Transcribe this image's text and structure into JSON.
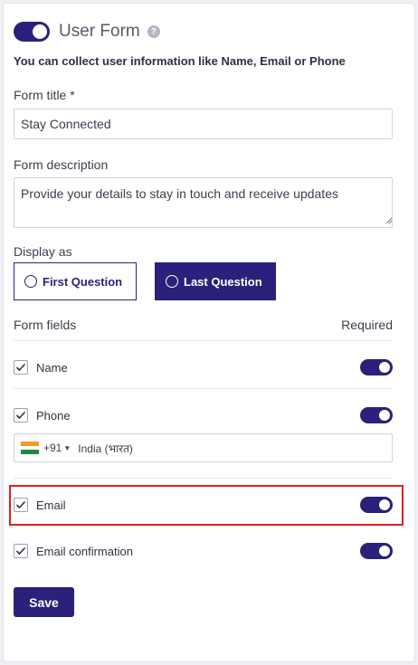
{
  "header": {
    "title": "User Form",
    "help_glyph": "?"
  },
  "subtitle": "You can collect user information like Name, Email or Phone",
  "form_title": {
    "label": "Form title *",
    "value": "Stay Connected"
  },
  "form_description": {
    "label": "Form description",
    "value": "Provide your details to stay in touch and receive updates"
  },
  "display_as": {
    "label": "Display as",
    "options": [
      "First Question",
      "Last Question"
    ],
    "selected": "Last Question"
  },
  "fields_header": {
    "left": "Form fields",
    "right": "Required"
  },
  "fields": [
    {
      "label": "Name",
      "checked": true,
      "required": true
    },
    {
      "label": "Phone",
      "checked": true,
      "required": true
    },
    {
      "label": "Email",
      "checked": true,
      "required": true
    },
    {
      "label": "Email confirmation",
      "checked": true,
      "required": true
    }
  ],
  "phone_input": {
    "dial_code": "+91",
    "country": "India (भारत)"
  },
  "save_label": "Save",
  "colors": {
    "accent": "#2b217a",
    "highlight": "#e0201f",
    "border": "#cfd3d9"
  },
  "icons": [
    "toggle-switch",
    "help-icon",
    "radio-icon",
    "checkbox-check-icon",
    "india-flag-icon",
    "caret-down-icon",
    "resize-grip-icon"
  ]
}
